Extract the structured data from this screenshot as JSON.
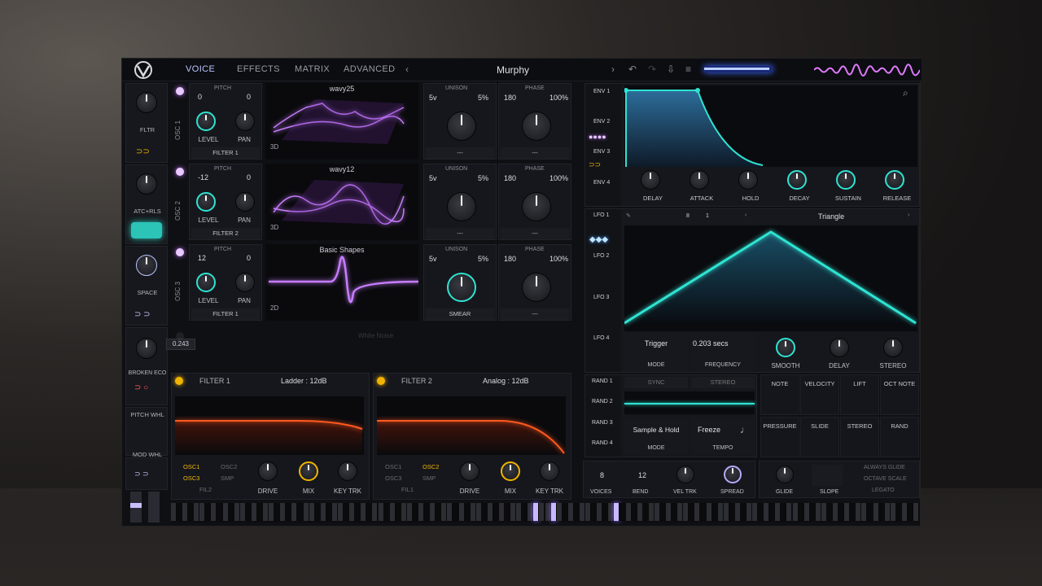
{
  "colors": {
    "accent": "#7fa0ff",
    "mod": "#2fe3d2",
    "osc": "#c77dff",
    "filter": "#ff5a1f",
    "knob_ring": "#f0b400"
  },
  "nav": {
    "tabs": [
      "VOICE",
      "EFFECTS",
      "MATRIX",
      "ADVANCED"
    ],
    "active": "VOICE",
    "preset": "Murphy"
  },
  "macros": [
    {
      "label": "FLTR"
    },
    {
      "label": "ATC+RLS"
    },
    {
      "label": "SPACE"
    },
    {
      "label": "BROKEN ECO",
      "tooltip": "0.243"
    },
    {
      "label": "PITCH WHL"
    },
    {
      "label": "MOD WHL"
    }
  ],
  "oscillators": [
    {
      "name": "OSC 1",
      "pitch_left": "0",
      "pitch_right": "0",
      "wavetable": "wavy25",
      "mode": "3D",
      "filter": "FILTER 1",
      "unison": "5v",
      "unison_pct": "5%",
      "phase": "180",
      "phase_pct": "100%",
      "knob_labels": [
        "LEVEL",
        "PAN"
      ],
      "bottom_left": "---",
      "bottom_right": "---"
    },
    {
      "name": "OSC 2",
      "pitch_left": "-12",
      "pitch_right": "0",
      "wavetable": "wavy12",
      "mode": "3D",
      "filter": "FILTER 2",
      "unison": "5v",
      "unison_pct": "5%",
      "phase": "180",
      "phase_pct": "100%",
      "knob_labels": [
        "LEVEL",
        "PAN"
      ],
      "bottom_left": "---",
      "bottom_right": "---"
    },
    {
      "name": "OSC 3",
      "pitch_left": "12",
      "pitch_right": "0",
      "wavetable": "Basic Shapes",
      "mode": "2D",
      "filter": "FILTER 1",
      "unison": "5v",
      "unison_pct": "5%",
      "phase": "180",
      "phase_pct": "100%",
      "knob_labels": [
        "LEVEL",
        "PAN"
      ],
      "bottom_left": "SMEAR",
      "bottom_right": "---"
    }
  ],
  "sampler": {
    "label": "White Noise"
  },
  "common": {
    "pitch": "PITCH",
    "unison": "UNISON",
    "phase": "PHASE"
  },
  "filters": [
    {
      "name": "FILTER 1",
      "type": "Ladder : 12dB",
      "routes": [
        "OSC1",
        "OSC2",
        "OSC3",
        "SMP",
        "FIL2"
      ],
      "knobs": [
        "DRIVE",
        "MIX",
        "KEY TRK"
      ]
    },
    {
      "name": "FILTER 2",
      "type": "Analog : 12dB",
      "routes": [
        "OSC1",
        "OSC2",
        "OSC3",
        "SMP",
        "FIL1"
      ],
      "knobs": [
        "DRIVE",
        "MIX",
        "KEY TRK"
      ]
    }
  ],
  "env": {
    "tabs": [
      "ENV 1",
      "ENV 2",
      "ENV 3",
      "ENV 4"
    ],
    "knobs": [
      "DELAY",
      "ATTACK",
      "HOLD",
      "DECAY",
      "SUSTAIN",
      "RELEASE"
    ]
  },
  "lfo": {
    "tabs": [
      "LFO 1",
      "LFO 2",
      "LFO 3",
      "LFO 4"
    ],
    "shape": "Triangle",
    "grid_left": "8",
    "grid_right": "1",
    "mode_value": "Trigger",
    "mode_label": "MODE",
    "freq_value": "0.203 secs",
    "freq_label": "FREQUENCY",
    "smooth": "SMOOTH",
    "delay": "DELAY",
    "stereo": "STEREO"
  },
  "rand": {
    "tabs": [
      "RAND 1",
      "RAND 2",
      "RAND 3",
      "RAND 4"
    ],
    "sync": "SYNC",
    "stereo": "STEREO",
    "mode_value": "Sample & Hold",
    "mode_label": "MODE",
    "tempo_value": "Freeze",
    "tempo_label": "TEMPO"
  },
  "mod_sources": [
    "NOTE",
    "VELOCITY",
    "LIFT",
    "OCT NOTE",
    "PRESSURE",
    "SLIDE",
    "STEREO",
    "RAND"
  ],
  "voice": {
    "voices": "8",
    "voices_label": "VOICES",
    "bend": "12",
    "bend_label": "BEND",
    "veltrk": "VEL TRK",
    "spread": "SPREAD",
    "glide": "GLIDE",
    "slope": "SLOPE",
    "options": [
      "ALWAYS GLIDE",
      "OCTAVE SCALE",
      "LEGATO"
    ]
  }
}
